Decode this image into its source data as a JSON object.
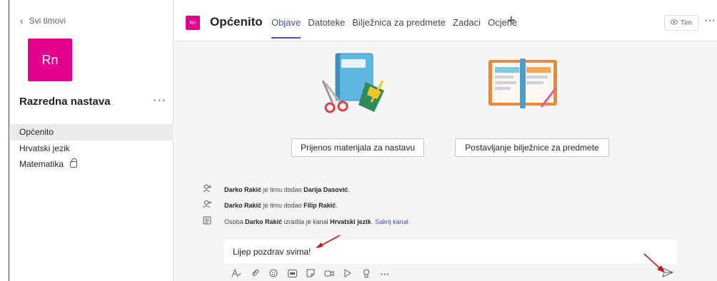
{
  "sidebar": {
    "back_label": "Svi timovi",
    "avatar_initials": "Rn",
    "team_name": "Razredna nastava",
    "more": "···",
    "channels": [
      {
        "label": "Općenito",
        "active": true
      },
      {
        "label": "Hrvatski jezik",
        "active": false
      },
      {
        "label": "Matematika",
        "active": false,
        "locked": true
      }
    ]
  },
  "header": {
    "avatar_initials": "Rn",
    "title": "Općenito",
    "tabs": [
      "Objave",
      "Datoteke",
      "Bilježnica za predmete",
      "Zadaci",
      "Ocjene"
    ],
    "active_tab": "Objave",
    "add_tab": "+",
    "team_button": "Tim",
    "more": "···"
  },
  "actions": {
    "upload_materials": "Prijenos materijala za nastavu",
    "setup_notebook": "Postavljanje bilježnice za predmete"
  },
  "feed": [
    {
      "icon": "person-add-icon",
      "actor": "Darko Rakić",
      "text": " je timu dodao ",
      "target": "Darija Dasović",
      "tail": "."
    },
    {
      "icon": "person-add-icon",
      "actor": "Darko Rakić",
      "text": " je timu dodao ",
      "target": "Filip Rakić",
      "tail": "."
    },
    {
      "icon": "channel-icon",
      "prefix": "Osoba ",
      "actor": "Darko Rakić",
      "text": " izradila je kanal ",
      "target": "Hrvatski jezik",
      "tail": ".",
      "link": "Sakrij kanal"
    }
  ],
  "compose": {
    "value": "Lijep pozdrav svima!"
  },
  "colors": {
    "brand": "#464eb8",
    "team_avatar": "#e3008c",
    "annotation_arrow": "#c4161c"
  }
}
